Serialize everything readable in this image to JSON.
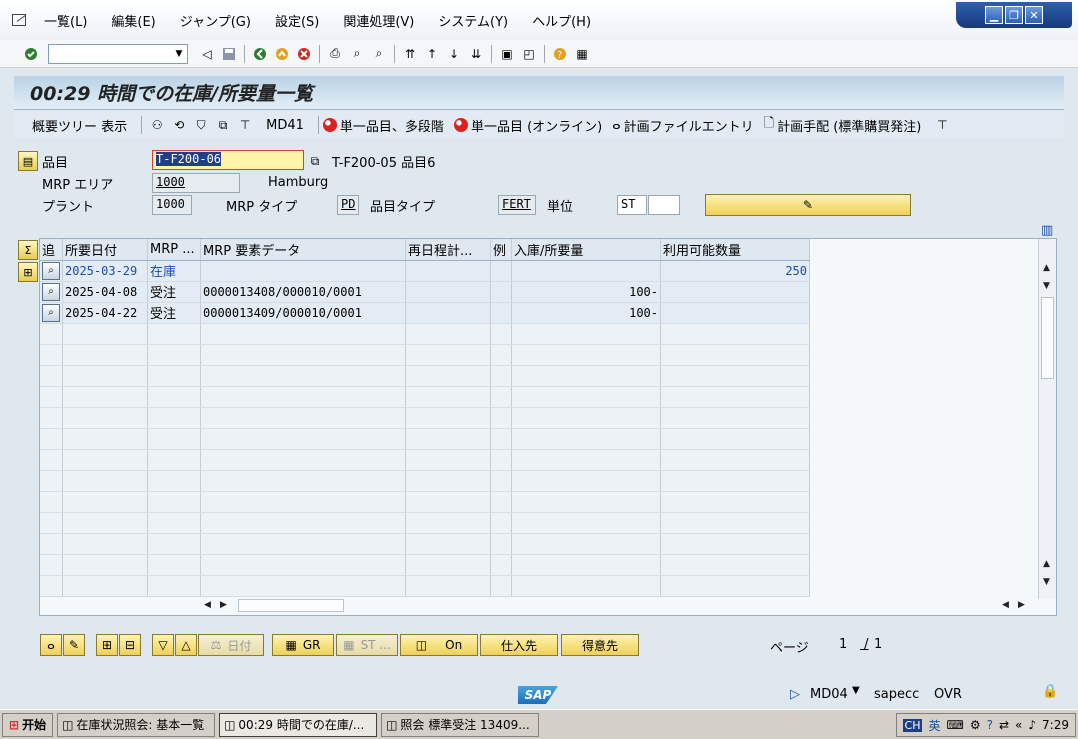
{
  "menubar": {
    "items": [
      "一覧(L)",
      "編集(E)",
      "ジャンプ(G)",
      "設定(S)",
      "関連処理(V)",
      "システム(Y)",
      "ヘルプ(H)"
    ]
  },
  "window_controls": {
    "minimize": "▁",
    "restore": "❐",
    "close": "✕"
  },
  "systoolbar": {
    "command_field_value": ""
  },
  "title": "00:29 時間での在庫/所要量一覧",
  "apptoolbar": {
    "overview_tree": "概要ツリー 表示",
    "md41": "MD41",
    "single_item_multi": "単一品目、多段階",
    "single_item_online": "単一品目 (オンライン)",
    "planning_file": "計画ファイルエントリ",
    "planning_procurement": "計画手配 (標準購買発注)"
  },
  "header": {
    "material_label": "品目",
    "material_value": "T-F200-06",
    "material_desc": "T-F200-05 品目6",
    "mrp_area_label": "MRP エリア",
    "mrp_area_value": "1000",
    "mrp_area_name": "Hamburg",
    "plant_label": "プラント",
    "plant_value": "1000",
    "mrp_type_label": "MRP タイプ",
    "mrp_type_value": "PD",
    "material_type_label": "品目タイプ",
    "material_type_value": "FERT",
    "unit_label": "単位",
    "unit_value": "ST"
  },
  "grid": {
    "columns": [
      "追",
      "所要日付",
      "MRP ...",
      "MRP 要素データ",
      "再日程計...",
      "例",
      "入庫/所要量",
      "利用可能数量"
    ],
    "rows": [
      {
        "date": "2025-03-29",
        "mrp": "在庫",
        "element": "",
        "reschedule": "",
        "exc": "",
        "qty": "",
        "available": "250"
      },
      {
        "date": "2025-04-08",
        "mrp": "受注",
        "element": "0000013408/000010/0001",
        "reschedule": "",
        "exc": "",
        "qty": "100-",
        "available": ""
      },
      {
        "date": "2025-04-22",
        "mrp": "受注",
        "element": "0000013409/000010/0001",
        "reschedule": "",
        "exc": "",
        "qty": "100-",
        "available": ""
      }
    ]
  },
  "bottom": {
    "date_btn": "日付",
    "gr_btn": "GR",
    "st_btn": "ST ...",
    "on_btn": "On",
    "vendor_btn": "仕入先",
    "customer_btn": "得意先",
    "page_label": "ページ",
    "page_current": "1",
    "page_total": "1"
  },
  "statusbar": {
    "logo": "SAP",
    "transaction": "MD04",
    "server": "sapecc",
    "mode": "OVR"
  },
  "taskbar": {
    "start": "开始",
    "tasks": [
      "在庫状況照会: 基本一覧",
      "00:29 時間での在庫/...",
      "照会 標準受注 13409..."
    ],
    "lang": "CH",
    "ime": "英",
    "clock": "7:29"
  },
  "colors": {
    "title_bg": "#b9d3e6",
    "button_yellow": "#eed05a",
    "row_blue_text": "#1a4ea8",
    "input_highlight": "#fff4a8"
  }
}
